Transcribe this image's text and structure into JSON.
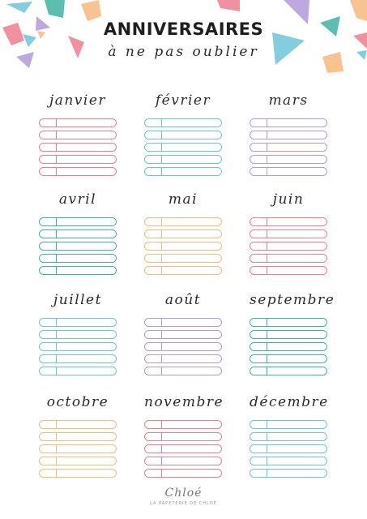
{
  "header": {
    "title": "ANNIVERSAIRES",
    "subtitle": "à ne pas oublier"
  },
  "colors": {
    "pink": "#ee7e8e",
    "teal": "#3fb3a3",
    "blue": "#6cc4d8",
    "purple": "#b39ad8",
    "orange": "#f6b97e"
  },
  "rows_per_month": 5,
  "months": [
    {
      "name": "janvier",
      "color": "#ee7e8e"
    },
    {
      "name": "février",
      "color": "#6cc4d8"
    },
    {
      "name": "mars",
      "color": "#b39ad8"
    },
    {
      "name": "avril",
      "color": "#3fb3a3"
    },
    {
      "name": "mai",
      "color": "#f6b97e"
    },
    {
      "name": "juin",
      "color": "#ee7e8e"
    },
    {
      "name": "juillet",
      "color": "#6cc4d8"
    },
    {
      "name": "août",
      "color": "#b39ad8"
    },
    {
      "name": "septembre",
      "color": "#3fb3a3"
    },
    {
      "name": "octobre",
      "color": "#f6b97e"
    },
    {
      "name": "novembre",
      "color": "#ee7e8e"
    },
    {
      "name": "décembre",
      "color": "#6cc4d8"
    }
  ],
  "footer": {
    "logo": "Chloé",
    "tagline": "la papeterie de chloé"
  }
}
